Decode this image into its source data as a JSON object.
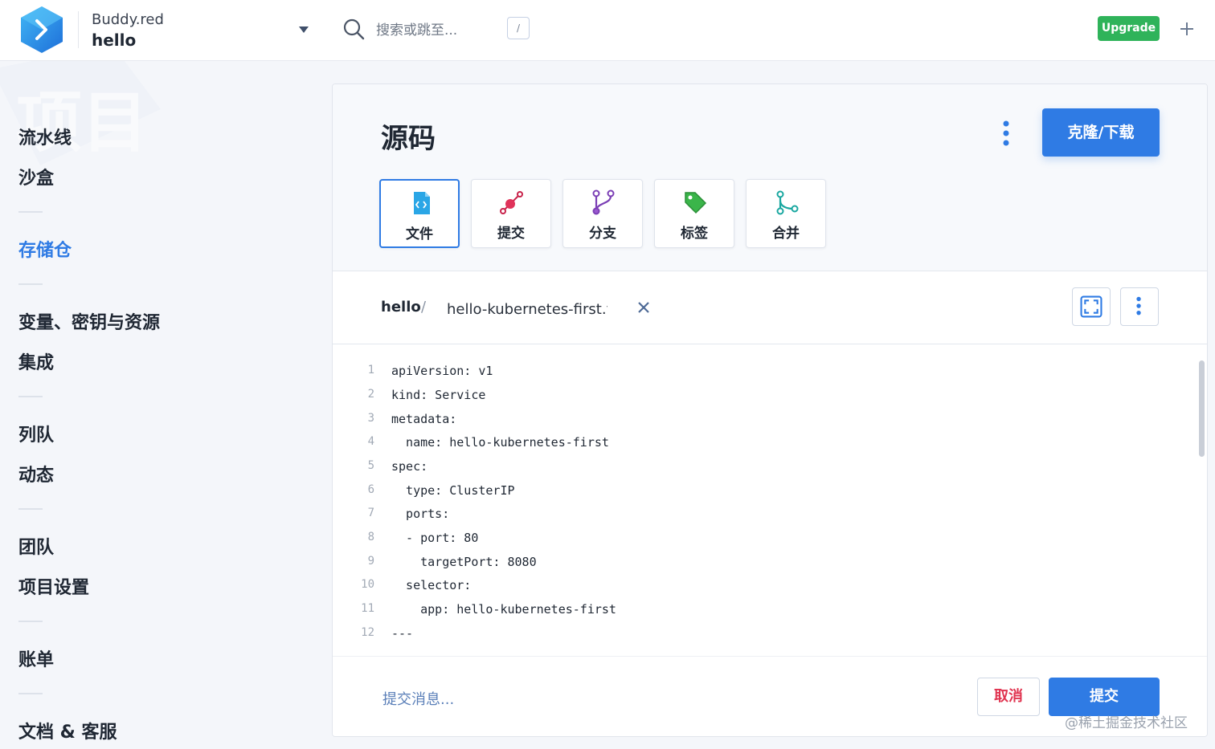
{
  "header": {
    "org_name": "Buddy.red",
    "project_name": "hello",
    "search_placeholder": "搜索或跳至...",
    "shortcut_key": "/",
    "upgrade_label": "Upgrade"
  },
  "sidebar": {
    "watermark_text": "项目",
    "items": [
      {
        "label": "流水线"
      },
      {
        "label": "沙盒"
      },
      {
        "label": "存储仓",
        "active": true
      },
      {
        "label": "变量、密钥与资源"
      },
      {
        "label": "集成"
      },
      {
        "label": "列队"
      },
      {
        "label": "动态"
      },
      {
        "label": "团队"
      },
      {
        "label": "项目设置"
      },
      {
        "label": "账单"
      },
      {
        "label": "文档 & 客服"
      }
    ]
  },
  "main": {
    "title": "源码",
    "clone_label": "克隆/下载",
    "tabs": [
      {
        "label": "文件",
        "icon": "file-code-icon",
        "color": "#2aa6e6",
        "active": true
      },
      {
        "label": "提交",
        "icon": "commit-icon",
        "color": "#c8224a"
      },
      {
        "label": "分支",
        "icon": "branch-icon",
        "color": "#7b3fb5"
      },
      {
        "label": "标签",
        "icon": "tag-icon",
        "color": "#3bb54a"
      },
      {
        "label": "合并",
        "icon": "merge-icon",
        "color": "#19a7a0"
      }
    ],
    "path": {
      "root": "hello",
      "separator": "/",
      "filename": "hello-kubernetes-first.yaml"
    },
    "code_lines": [
      {
        "n": "1",
        "text": "apiVersion: v1"
      },
      {
        "n": "2",
        "text": "kind: Service"
      },
      {
        "n": "3",
        "text": "metadata:"
      },
      {
        "n": "4",
        "text": "  name: hello-kubernetes-first"
      },
      {
        "n": "5",
        "text": "spec:"
      },
      {
        "n": "6",
        "text": "  type: ClusterIP"
      },
      {
        "n": "7",
        "text": "  ports:"
      },
      {
        "n": "8",
        "text": "  - port: 80"
      },
      {
        "n": "9",
        "text": "    targetPort: 8080"
      },
      {
        "n": "10",
        "text": "  selector:"
      },
      {
        "n": "11",
        "text": "    app: hello-kubernetes-first"
      },
      {
        "n": "12",
        "text": "---"
      }
    ],
    "commit_placeholder": "提交消息...",
    "cancel_label": "取消",
    "submit_label": "提交"
  },
  "watermark_credit": "@稀土掘金技术社区",
  "colors": {
    "accent": "#2f7be4",
    "upgrade": "#2fb35a",
    "danger": "#e0334f"
  }
}
